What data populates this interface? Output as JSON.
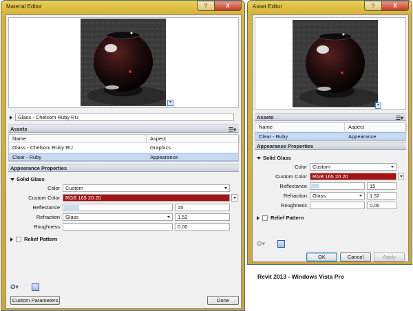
{
  "material_editor": {
    "title": "Material Editor",
    "window_buttons": {
      "help": "?",
      "close": "X"
    },
    "material_name": "Glass - Chelsom Ruby RU",
    "assets_heading": "Assets",
    "table": {
      "headers": [
        "Name",
        "Aspect"
      ],
      "rows": [
        {
          "name": "Glass - Chelsom Ruby RU",
          "aspect": "Graphics",
          "selected": false
        },
        {
          "name": "Clear - Ruby",
          "aspect": "Appearance",
          "selected": true
        }
      ]
    },
    "properties_heading": "Appearance Properties",
    "group_title": "Solid Glass",
    "properties": {
      "color_label": "Color",
      "color_value": "Custom",
      "custom_color_label": "Custom Color",
      "custom_color_value": "RGB 165 20 20",
      "reflectance_label": "Reflectance",
      "reflectance_value": "15",
      "refraction_label": "Refraction",
      "refraction_select": "Glass",
      "refraction_value": "1.52",
      "roughness_label": "Roughness",
      "roughness_value": "0.00"
    },
    "relief_pattern_label": "Relief Pattern",
    "custom_parameters_label": "Custom Parameters",
    "done_label": "Done"
  },
  "asset_editor": {
    "title": "Asset Editor",
    "window_buttons": {
      "help": "?",
      "close": "X"
    },
    "assets_heading": "Assets",
    "table": {
      "headers": [
        "Name",
        "Aspect"
      ],
      "rows": [
        {
          "name": "Clear - Ruby",
          "aspect": "Appearance",
          "selected": true
        }
      ]
    },
    "properties_heading": "Appearance Properties",
    "group_title": "Solid Glass",
    "properties": {
      "color_label": "Color",
      "color_value": "Custom",
      "custom_color_label": "Custom Color",
      "custom_color_value": "RGB 165 20 20",
      "reflectance_label": "Reflectance",
      "reflectance_value": "15",
      "refraction_label": "Refraction",
      "refraction_select": "Glass",
      "refraction_value": "1.52",
      "roughness_label": "Roughness",
      "roughness_value": "0.00"
    },
    "relief_pattern_label": "Relief Pattern",
    "ok_label": "OK",
    "cancel_label": "Cancel",
    "apply_label": "Apply"
  },
  "caption": "Revit 2013 - Windows Vista Pro",
  "colors": {
    "custom_color": "#a51414",
    "selection": "#c6daf3",
    "title_bar": "#d8b43a"
  },
  "icons": [
    "list-view-icon",
    "expand-arrow-icon",
    "collapse-arrow-icon",
    "dropdown-arrow-icon",
    "sphere-preview-icon",
    "asset-browser-icon"
  ]
}
